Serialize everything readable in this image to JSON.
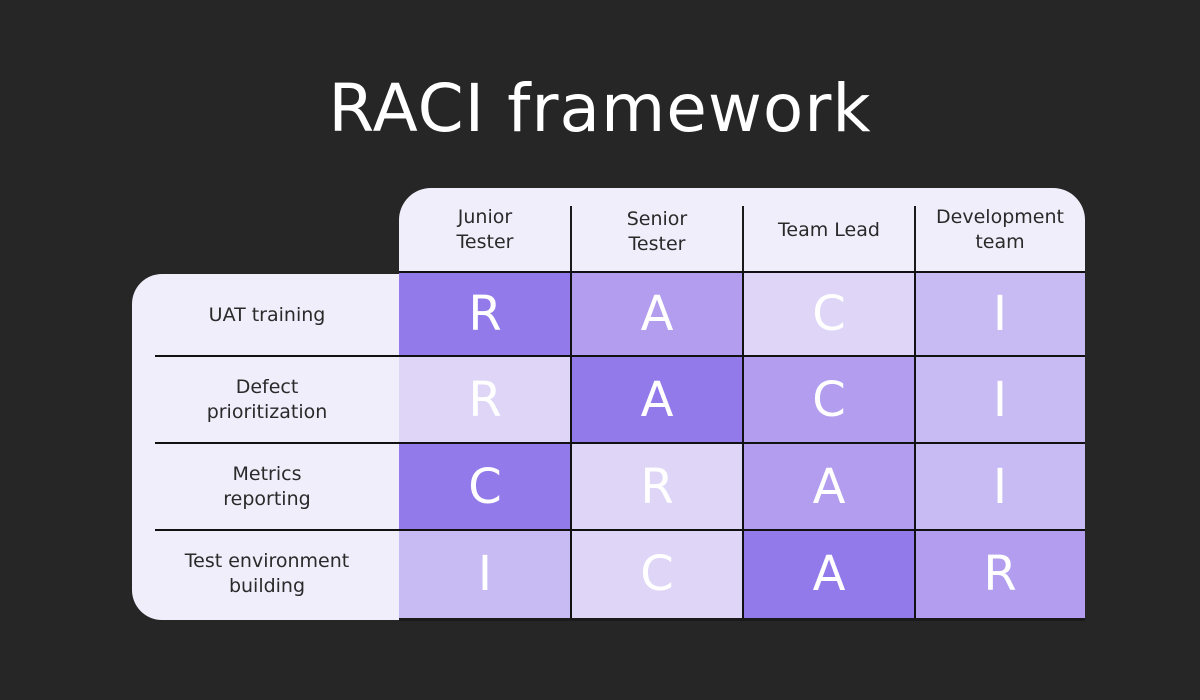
{
  "title": "RACI framework",
  "columns": [
    {
      "label_l1": "Junior",
      "label_l2": "Tester"
    },
    {
      "label_l1": "Senior",
      "label_l2": "Tester"
    },
    {
      "label_l1": "Team Lead",
      "label_l2": ""
    },
    {
      "label_l1": "Development",
      "label_l2": "team"
    }
  ],
  "rows": [
    {
      "label_l1": "UAT training",
      "label_l2": "",
      "cells": [
        "R",
        "A",
        "C",
        "I"
      ]
    },
    {
      "label_l1": "Defect",
      "label_l2": "prioritization",
      "cells": [
        "R",
        "A",
        "C",
        "I"
      ]
    },
    {
      "label_l1": "Metrics",
      "label_l2": "reporting",
      "cells": [
        "C",
        "R",
        "A",
        "I"
      ]
    },
    {
      "label_l1": "Test environment",
      "label_l2": "building",
      "cells": [
        "I",
        "C",
        "A",
        "R"
      ]
    }
  ],
  "cell_shades": [
    [
      "dark",
      "mid",
      "light",
      "lightmid"
    ],
    [
      "light",
      "dark",
      "mid",
      "lightmid"
    ],
    [
      "dark",
      "light",
      "mid",
      "lightmid"
    ],
    [
      "lightmid",
      "light",
      "dark",
      "mid"
    ]
  ],
  "colors": {
    "background": "#262626",
    "panel": "#F1EEFB",
    "dark": "#937AEB",
    "mid": "#B29DEF",
    "lightmid": "#C8BBF4",
    "light": "#DED5F7"
  }
}
